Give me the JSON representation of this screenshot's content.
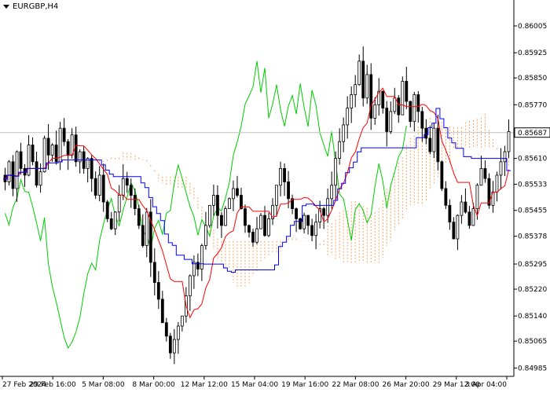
{
  "window": {
    "symbol_title": "EURGBP,H4"
  },
  "price_box": {
    "value": "0.85687",
    "color": "#000000",
    "bg": "#ffffff"
  },
  "colors": {
    "candles": "#000000",
    "tenkan": "#ff0000",
    "kijun": "#0000ff",
    "chikou": "#00cc00",
    "kumo": "#f4a460",
    "current_line": "#c0c0c0"
  },
  "chart_data": {
    "type": "candlestick",
    "instrument": "EURGBP",
    "timeframe": "H4",
    "ylim": [
      0.8496,
      0.8608
    ],
    "y_ticks": [
      "0.86005",
      "0.85925",
      "0.85850",
      "0.85770",
      "0.85690",
      "0.85610",
      "0.85533",
      "0.85455",
      "0.85378",
      "0.85295",
      "0.85220",
      "0.85140",
      "0.85065",
      "0.84985"
    ],
    "x_ticks": [
      "27 Feb 2024",
      "29 Feb 16:00",
      "5 Mar 08:00",
      "8 Mar 00:00",
      "12 Mar 12:00",
      "15 Mar 04:00",
      "19 Mar 16:00",
      "22 Mar 08:00",
      "26 Mar 20:00",
      "29 Mar 12:00",
      "3 Apr 04:00"
    ],
    "current_price": 0.85687,
    "indicator": "Ichimoku Kinko Hyo",
    "close_series": [
      0.8554,
      0.856,
      0.8552,
      0.8563,
      0.8558,
      0.8556,
      0.8565,
      0.856,
      0.8553,
      0.8557,
      0.8567,
      0.8562,
      0.8565,
      0.856,
      0.857,
      0.8566,
      0.8562,
      0.8568,
      0.856,
      0.8563,
      0.8558,
      0.8561,
      0.8555,
      0.855,
      0.8556,
      0.8548,
      0.8543,
      0.854,
      0.8545,
      0.855,
      0.8555,
      0.8553,
      0.855,
      0.8546,
      0.8541,
      0.8535,
      0.8545,
      0.853,
      0.8524,
      0.8519,
      0.8512,
      0.8508,
      0.8503,
      0.8507,
      0.8511,
      0.8514,
      0.852,
      0.8526,
      0.853,
      0.8528,
      0.8535,
      0.8541,
      0.8547,
      0.855,
      0.8544,
      0.8541,
      0.8546,
      0.8549,
      0.8552,
      0.855,
      0.8546,
      0.8541,
      0.8539,
      0.8536,
      0.854,
      0.8544,
      0.8538,
      0.8543,
      0.8547,
      0.8553,
      0.8558,
      0.8554,
      0.8549,
      0.8546,
      0.8543,
      0.854,
      0.8544,
      0.8541,
      0.8538,
      0.8542,
      0.8546,
      0.8544,
      0.8549,
      0.8553,
      0.8561,
      0.8566,
      0.8571,
      0.8576,
      0.858,
      0.8583,
      0.859,
      0.8579,
      0.8586,
      0.8573,
      0.8577,
      0.8581,
      0.8576,
      0.8569,
      0.8575,
      0.8579,
      0.8574,
      0.8584,
      0.8578,
      0.8572,
      0.858,
      0.8575,
      0.857,
      0.8567,
      0.8563,
      0.857,
      0.856,
      0.8552,
      0.8547,
      0.8542,
      0.8537,
      0.8544,
      0.8548,
      0.8545,
      0.8541,
      0.8546,
      0.8553,
      0.8558,
      0.8555,
      0.8547,
      0.8551,
      0.8556,
      0.856,
      0.8563,
      0.8569
    ]
  }
}
